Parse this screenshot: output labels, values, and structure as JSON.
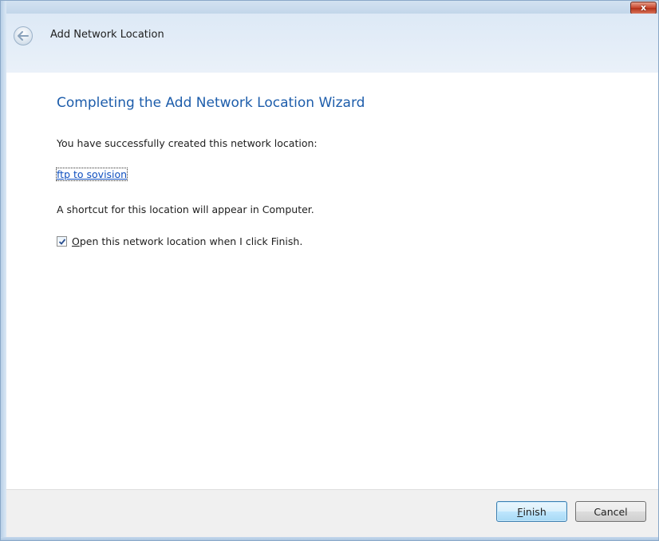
{
  "window": {
    "close_glyph": "x",
    "close_icon": "close-icon"
  },
  "nav": {
    "back_icon": "back-arrow-icon",
    "title": "Add Network Location"
  },
  "main": {
    "heading": "Completing the Add Network Location Wizard",
    "success_text": "You have successfully created this network location:",
    "location_link": "ftp to sovision",
    "shortcut_text": "A shortcut for this location will appear in Computer.",
    "open_checkbox": {
      "checked": true,
      "label_accel": "O",
      "label_rest": "pen this network location when I click Finish."
    }
  },
  "footer": {
    "finish_accel": "F",
    "finish_rest": "inish",
    "cancel_label": "Cancel"
  },
  "colors": {
    "heading": "#1d5dab",
    "link": "#0f4fbf",
    "footer_bg": "#f0f0f0"
  }
}
